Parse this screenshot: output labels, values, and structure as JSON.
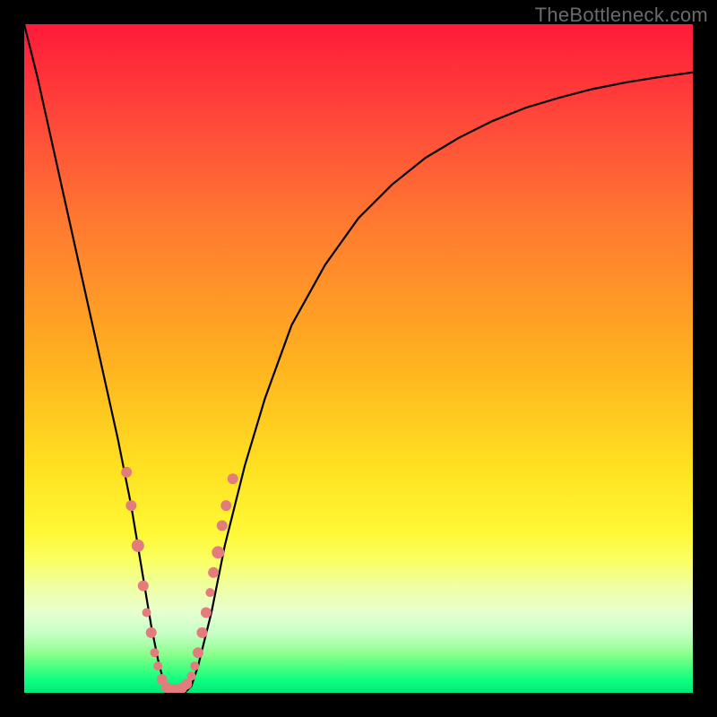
{
  "watermark": "TheBottleneck.com",
  "chart_data": {
    "type": "line",
    "title": "",
    "xlabel": "",
    "ylabel": "",
    "xlim": [
      0,
      100
    ],
    "ylim": [
      0,
      100
    ],
    "grid": false,
    "series": [
      {
        "name": "bottleneck-curve",
        "x": [
          0,
          2,
          4,
          6,
          8,
          10,
          12,
          14,
          16,
          18,
          19,
          20,
          21,
          22,
          23,
          24,
          25,
          26,
          28,
          30,
          33,
          36,
          40,
          45,
          50,
          55,
          60,
          65,
          70,
          75,
          80,
          85,
          90,
          95,
          100
        ],
        "values": [
          100,
          92,
          83,
          74,
          65,
          56,
          47,
          38,
          28,
          16,
          10,
          5,
          1,
          0,
          0,
          0,
          1,
          4,
          12,
          22,
          34,
          44,
          55,
          64,
          71,
          76,
          80,
          83,
          85.5,
          87.5,
          89,
          90.3,
          91.3,
          92.1,
          92.8
        ]
      }
    ],
    "scatter": {
      "name": "data-points",
      "color": "#e37c7c",
      "points": [
        {
          "x": 15.3,
          "y": 33,
          "r": 6
        },
        {
          "x": 16.0,
          "y": 28,
          "r": 6
        },
        {
          "x": 17.0,
          "y": 22,
          "r": 7
        },
        {
          "x": 17.8,
          "y": 16,
          "r": 6
        },
        {
          "x": 18.3,
          "y": 12,
          "r": 5
        },
        {
          "x": 19.0,
          "y": 9,
          "r": 6
        },
        {
          "x": 19.5,
          "y": 6,
          "r": 5
        },
        {
          "x": 20.0,
          "y": 4,
          "r": 5
        },
        {
          "x": 20.6,
          "y": 2,
          "r": 6
        },
        {
          "x": 21.3,
          "y": 0.8,
          "r": 6
        },
        {
          "x": 22.0,
          "y": 0.5,
          "r": 6
        },
        {
          "x": 22.8,
          "y": 0.5,
          "r": 6
        },
        {
          "x": 23.6,
          "y": 0.7,
          "r": 6
        },
        {
          "x": 24.3,
          "y": 1.3,
          "r": 6
        },
        {
          "x": 25.0,
          "y": 2.5,
          "r": 5
        },
        {
          "x": 25.5,
          "y": 4,
          "r": 5
        },
        {
          "x": 26.0,
          "y": 6,
          "r": 6
        },
        {
          "x": 26.6,
          "y": 9,
          "r": 6
        },
        {
          "x": 27.2,
          "y": 12,
          "r": 6
        },
        {
          "x": 27.8,
          "y": 15,
          "r": 5
        },
        {
          "x": 28.3,
          "y": 18,
          "r": 6
        },
        {
          "x": 29.0,
          "y": 21,
          "r": 7
        },
        {
          "x": 29.6,
          "y": 25,
          "r": 6
        },
        {
          "x": 30.2,
          "y": 28,
          "r": 6
        },
        {
          "x": 31.2,
          "y": 32,
          "r": 6
        }
      ]
    }
  }
}
